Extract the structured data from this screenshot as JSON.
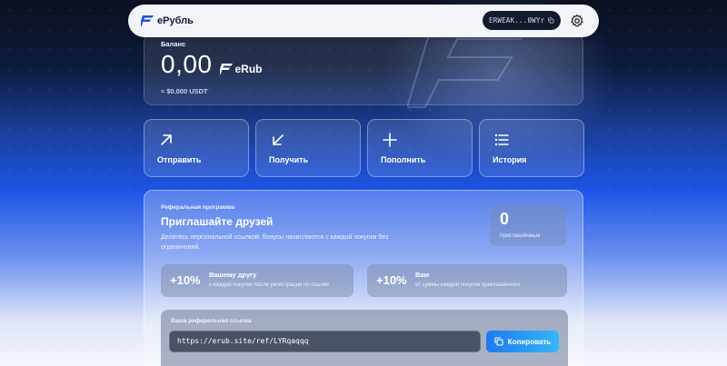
{
  "header": {
    "brand": "еРубль",
    "wallet_address": "ERWEAK...0WYr"
  },
  "balance": {
    "label": "Баланс",
    "amount": "0,00",
    "currency": "eRub",
    "usd": "≈ $0.000 USDT"
  },
  "actions": [
    {
      "label": "Отправить",
      "icon": "arrow-up-right-icon"
    },
    {
      "label": "Получить",
      "icon": "arrow-down-left-icon"
    },
    {
      "label": "Пополнить",
      "icon": "plus-icon"
    },
    {
      "label": "История",
      "icon": "list-icon"
    }
  ],
  "referral": {
    "kicker": "Реферальная программа",
    "title": "Приглашайте друзей",
    "description": "Делитесь персональной ссылкой: бонусы начисляются с каждой покупки без ограничений.",
    "count": "0",
    "count_label": "приглашённых",
    "bonus_friend": {
      "percent": "+10%",
      "title": "Вашему другу",
      "subtitle": "к каждой покупке после регистрации по ссылке"
    },
    "bonus_you": {
      "percent": "+10%",
      "title": "Вам",
      "subtitle": "от суммы каждой покупки приглашённого"
    },
    "link_label": "Ваша реферальная ссылка",
    "link_value": "https://erub.site/ref/LYRqaqqq",
    "copy_label": "Копировать"
  },
  "colors": {
    "accent": "#1e7af0",
    "accent_light": "#35b6f5",
    "header_bg": "#f3f4f7",
    "wallet_chip_bg": "#121a2e"
  }
}
